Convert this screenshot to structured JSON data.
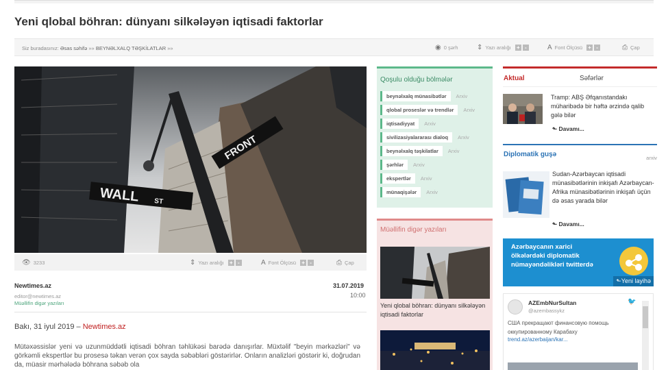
{
  "article": {
    "title": "Yeni qlobal böhran: dünyanı silkələyən iqtisadi faktorlar",
    "breadcrumb": {
      "prefix": "Siz buradasınız:",
      "home": "Əsas səhifə",
      "sep1": "»»",
      "section": "BEYNƏLXALQ TƏŞKİLATLAR",
      "sep2": "»»"
    },
    "toolbar": {
      "comments": "0 şərh",
      "line_spacing": "Yazı aralığı",
      "font_size": "Font Ölçüsü",
      "print": "Çap",
      "plus": "+",
      "minus": "-"
    },
    "infobar": {
      "views": "3233",
      "line_spacing": "Yazı aralığı",
      "font_size": "Font Ölçüsü",
      "print": "Çap"
    },
    "source": "Newtimes.az",
    "email": "editor@newtimes.az",
    "other_posts": "Müəllifin digər yazıları",
    "date": "31.07.2019",
    "time": "10:00",
    "lead_prefix": "Bakı, 31 iyul 2019 – ",
    "lead_link": "Newtimes.az",
    "body": "Mütəxəssislər yeni və uzunmüddətli iqtisadi böhran təhlükəsi barədə danışırlar. Müxtəlif \"beyin mərkəzləri\" və görkəmli ekspertlər bu prosesə təkan verən çox sayda səbəbləri göstərirlər. Onların analizləri göstərir ki, doğrudan da, müasir mərhələdə böhrana səbəb ola",
    "hero_signs": {
      "wall": "WALL",
      "st": "ST",
      "front": "FRONT"
    }
  },
  "sections_box": {
    "title": "Qoşulu olduğu bölmələr",
    "items": [
      {
        "label": "beynəlxalq münasibətlər",
        "archive": "Arxiv"
      },
      {
        "label": "qlobal proseslər və trendlər",
        "archive": "Arxiv"
      },
      {
        "label": "iqtisadiyyat",
        "archive": "Arxiv"
      },
      {
        "label": "sivilizasiyalararası dialoq",
        "archive": "Arxiv"
      },
      {
        "label": "beynəlxalq təşkilatlar",
        "archive": "Arxiv"
      },
      {
        "label": "şərhlər",
        "archive": "Arxiv"
      },
      {
        "label": "ekspertlər",
        "archive": "Arxiv"
      },
      {
        "label": "münaqişələr",
        "archive": "Arxiv"
      }
    ]
  },
  "author_box": {
    "title": "Müəllifin digər yazıları",
    "post_title": "Yeni qlobal böhran: dünyanı silkələyən iqtisadi faktorlar"
  },
  "right": {
    "tab_active": "Aktual",
    "tab_other": "Səfərlər",
    "news1": {
      "text": "Tramp: ABŞ Əfqanıstandakı müharibədə bir həftə ərzində qalib gələ bilər",
      "more": "Davamı..."
    },
    "dip_title": "Diplomatik guşə",
    "dip_archive": "arxiv",
    "news2": {
      "text": "Sudan-Azərbaycan iqtisadi münasibətlərinin inkişafı Azərbaycan-Afrika münasibətlərinin inkişafı üçün də əsas yarada bilər",
      "more": "Davamı..."
    },
    "banner": {
      "line1": "Azərbaycanın xarici",
      "line2": "ölkələrdəki diplomatik",
      "line3": "nümayəndəlikləri twitterdə",
      "new": "Yeni layihə"
    },
    "tweet": {
      "name": "AZEmbNurSultan",
      "handle": "@azembassykz",
      "text": "США прекращают финансовую помощь оккупированному Карабаху",
      "link": "trend.az/azerbaijan/kar..."
    }
  },
  "colors": {
    "green": "#5cb88a",
    "pink": "#e08a8a",
    "red": "#c32a2a",
    "blue": "#2b73b5"
  }
}
